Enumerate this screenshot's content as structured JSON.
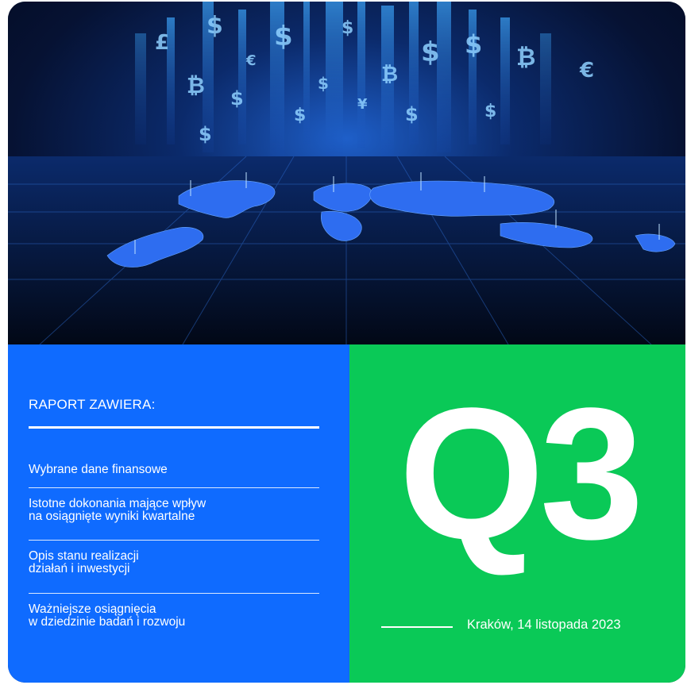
{
  "hero": {
    "image": "finance-world-map-hero",
    "currency_symbols": [
      "$",
      "€",
      "£",
      "₿",
      "¥"
    ]
  },
  "report": {
    "heading": "RAPORT ZAWIERA:",
    "items": [
      {
        "lines": [
          "Wybrane dane finansowe"
        ]
      },
      {
        "lines": [
          "Istotne dokonania mające wpływ",
          "na osiągnięte wyniki kwartalne"
        ]
      },
      {
        "lines": [
          "Opis stanu realizacji",
          "działań i inwestycji"
        ]
      },
      {
        "lines": [
          "Ważniejsze osiągnięcia",
          "w dziedzinie badań i rozwoju"
        ]
      }
    ]
  },
  "quarter": {
    "label": "Q3",
    "location_date": "Kraków, 14 listopada 2023"
  },
  "colors": {
    "blue_panel": "#0f6bff",
    "green_panel": "#0ac957",
    "text": "#ffffff"
  }
}
